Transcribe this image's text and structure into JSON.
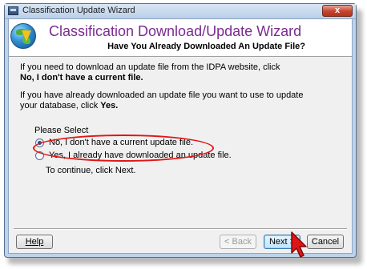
{
  "window": {
    "title": "Classification Update Wizard",
    "close_label": "x"
  },
  "header": {
    "title": "Classification Download/Update Wizard",
    "subtitle": "Have You Already Downloaded An Update File?"
  },
  "body": {
    "para1_line1": "If you need to download an update file from the IDPA website, click",
    "para1_line2": "No, I don't have a current file.",
    "para2_line1": "If you have already downloaded an update file you want to use to update",
    "para2_line2_prefix": "your database, click ",
    "para2_line2_bold": "Yes.",
    "group_label": "Please Select",
    "options": [
      {
        "label": "No, I don't have a current update file.",
        "checked": true
      },
      {
        "label": "Yes, I already have downloaded an update file.",
        "checked": false
      }
    ],
    "continue_text": "To continue, click Next."
  },
  "footer": {
    "help": "Help",
    "back": "< Back",
    "next": "Next >",
    "cancel": "Cancel"
  },
  "colors": {
    "title_purple": "#7b2b91",
    "highlight_red": "#e01515",
    "close_red": "#c5452e"
  }
}
